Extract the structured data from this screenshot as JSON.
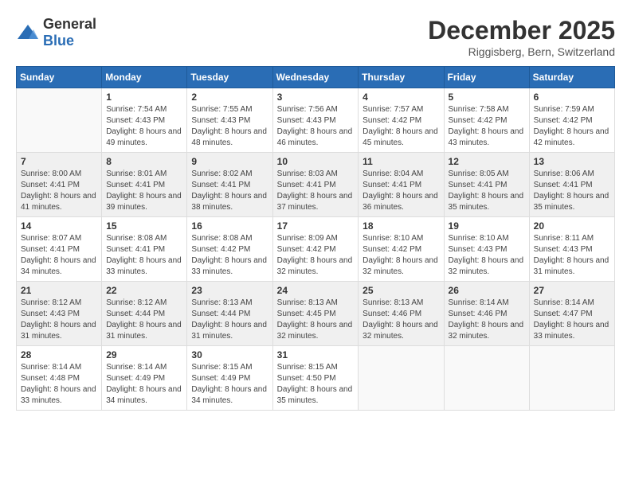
{
  "logo": {
    "text_general": "General",
    "text_blue": "Blue"
  },
  "header": {
    "month": "December 2025",
    "location": "Riggisberg, Bern, Switzerland"
  },
  "weekdays": [
    "Sunday",
    "Monday",
    "Tuesday",
    "Wednesday",
    "Thursday",
    "Friday",
    "Saturday"
  ],
  "weeks": [
    [
      {
        "day": "",
        "sunrise": "",
        "sunset": "",
        "daylight": ""
      },
      {
        "day": "1",
        "sunrise": "Sunrise: 7:54 AM",
        "sunset": "Sunset: 4:43 PM",
        "daylight": "Daylight: 8 hours and 49 minutes."
      },
      {
        "day": "2",
        "sunrise": "Sunrise: 7:55 AM",
        "sunset": "Sunset: 4:43 PM",
        "daylight": "Daylight: 8 hours and 48 minutes."
      },
      {
        "day": "3",
        "sunrise": "Sunrise: 7:56 AM",
        "sunset": "Sunset: 4:43 PM",
        "daylight": "Daylight: 8 hours and 46 minutes."
      },
      {
        "day": "4",
        "sunrise": "Sunrise: 7:57 AM",
        "sunset": "Sunset: 4:42 PM",
        "daylight": "Daylight: 8 hours and 45 minutes."
      },
      {
        "day": "5",
        "sunrise": "Sunrise: 7:58 AM",
        "sunset": "Sunset: 4:42 PM",
        "daylight": "Daylight: 8 hours and 43 minutes."
      },
      {
        "day": "6",
        "sunrise": "Sunrise: 7:59 AM",
        "sunset": "Sunset: 4:42 PM",
        "daylight": "Daylight: 8 hours and 42 minutes."
      }
    ],
    [
      {
        "day": "7",
        "sunrise": "Sunrise: 8:00 AM",
        "sunset": "Sunset: 4:41 PM",
        "daylight": "Daylight: 8 hours and 41 minutes."
      },
      {
        "day": "8",
        "sunrise": "Sunrise: 8:01 AM",
        "sunset": "Sunset: 4:41 PM",
        "daylight": "Daylight: 8 hours and 39 minutes."
      },
      {
        "day": "9",
        "sunrise": "Sunrise: 8:02 AM",
        "sunset": "Sunset: 4:41 PM",
        "daylight": "Daylight: 8 hours and 38 minutes."
      },
      {
        "day": "10",
        "sunrise": "Sunrise: 8:03 AM",
        "sunset": "Sunset: 4:41 PM",
        "daylight": "Daylight: 8 hours and 37 minutes."
      },
      {
        "day": "11",
        "sunrise": "Sunrise: 8:04 AM",
        "sunset": "Sunset: 4:41 PM",
        "daylight": "Daylight: 8 hours and 36 minutes."
      },
      {
        "day": "12",
        "sunrise": "Sunrise: 8:05 AM",
        "sunset": "Sunset: 4:41 PM",
        "daylight": "Daylight: 8 hours and 35 minutes."
      },
      {
        "day": "13",
        "sunrise": "Sunrise: 8:06 AM",
        "sunset": "Sunset: 4:41 PM",
        "daylight": "Daylight: 8 hours and 35 minutes."
      }
    ],
    [
      {
        "day": "14",
        "sunrise": "Sunrise: 8:07 AM",
        "sunset": "Sunset: 4:41 PM",
        "daylight": "Daylight: 8 hours and 34 minutes."
      },
      {
        "day": "15",
        "sunrise": "Sunrise: 8:08 AM",
        "sunset": "Sunset: 4:41 PM",
        "daylight": "Daylight: 8 hours and 33 minutes."
      },
      {
        "day": "16",
        "sunrise": "Sunrise: 8:08 AM",
        "sunset": "Sunset: 4:42 PM",
        "daylight": "Daylight: 8 hours and 33 minutes."
      },
      {
        "day": "17",
        "sunrise": "Sunrise: 8:09 AM",
        "sunset": "Sunset: 4:42 PM",
        "daylight": "Daylight: 8 hours and 32 minutes."
      },
      {
        "day": "18",
        "sunrise": "Sunrise: 8:10 AM",
        "sunset": "Sunset: 4:42 PM",
        "daylight": "Daylight: 8 hours and 32 minutes."
      },
      {
        "day": "19",
        "sunrise": "Sunrise: 8:10 AM",
        "sunset": "Sunset: 4:43 PM",
        "daylight": "Daylight: 8 hours and 32 minutes."
      },
      {
        "day": "20",
        "sunrise": "Sunrise: 8:11 AM",
        "sunset": "Sunset: 4:43 PM",
        "daylight": "Daylight: 8 hours and 31 minutes."
      }
    ],
    [
      {
        "day": "21",
        "sunrise": "Sunrise: 8:12 AM",
        "sunset": "Sunset: 4:43 PM",
        "daylight": "Daylight: 8 hours and 31 minutes."
      },
      {
        "day": "22",
        "sunrise": "Sunrise: 8:12 AM",
        "sunset": "Sunset: 4:44 PM",
        "daylight": "Daylight: 8 hours and 31 minutes."
      },
      {
        "day": "23",
        "sunrise": "Sunrise: 8:13 AM",
        "sunset": "Sunset: 4:44 PM",
        "daylight": "Daylight: 8 hours and 31 minutes."
      },
      {
        "day": "24",
        "sunrise": "Sunrise: 8:13 AM",
        "sunset": "Sunset: 4:45 PM",
        "daylight": "Daylight: 8 hours and 32 minutes."
      },
      {
        "day": "25",
        "sunrise": "Sunrise: 8:13 AM",
        "sunset": "Sunset: 4:46 PM",
        "daylight": "Daylight: 8 hours and 32 minutes."
      },
      {
        "day": "26",
        "sunrise": "Sunrise: 8:14 AM",
        "sunset": "Sunset: 4:46 PM",
        "daylight": "Daylight: 8 hours and 32 minutes."
      },
      {
        "day": "27",
        "sunrise": "Sunrise: 8:14 AM",
        "sunset": "Sunset: 4:47 PM",
        "daylight": "Daylight: 8 hours and 33 minutes."
      }
    ],
    [
      {
        "day": "28",
        "sunrise": "Sunrise: 8:14 AM",
        "sunset": "Sunset: 4:48 PM",
        "daylight": "Daylight: 8 hours and 33 minutes."
      },
      {
        "day": "29",
        "sunrise": "Sunrise: 8:14 AM",
        "sunset": "Sunset: 4:49 PM",
        "daylight": "Daylight: 8 hours and 34 minutes."
      },
      {
        "day": "30",
        "sunrise": "Sunrise: 8:15 AM",
        "sunset": "Sunset: 4:49 PM",
        "daylight": "Daylight: 8 hours and 34 minutes."
      },
      {
        "day": "31",
        "sunrise": "Sunrise: 8:15 AM",
        "sunset": "Sunset: 4:50 PM",
        "daylight": "Daylight: 8 hours and 35 minutes."
      },
      {
        "day": "",
        "sunrise": "",
        "sunset": "",
        "daylight": ""
      },
      {
        "day": "",
        "sunrise": "",
        "sunset": "",
        "daylight": ""
      },
      {
        "day": "",
        "sunrise": "",
        "sunset": "",
        "daylight": ""
      }
    ]
  ]
}
